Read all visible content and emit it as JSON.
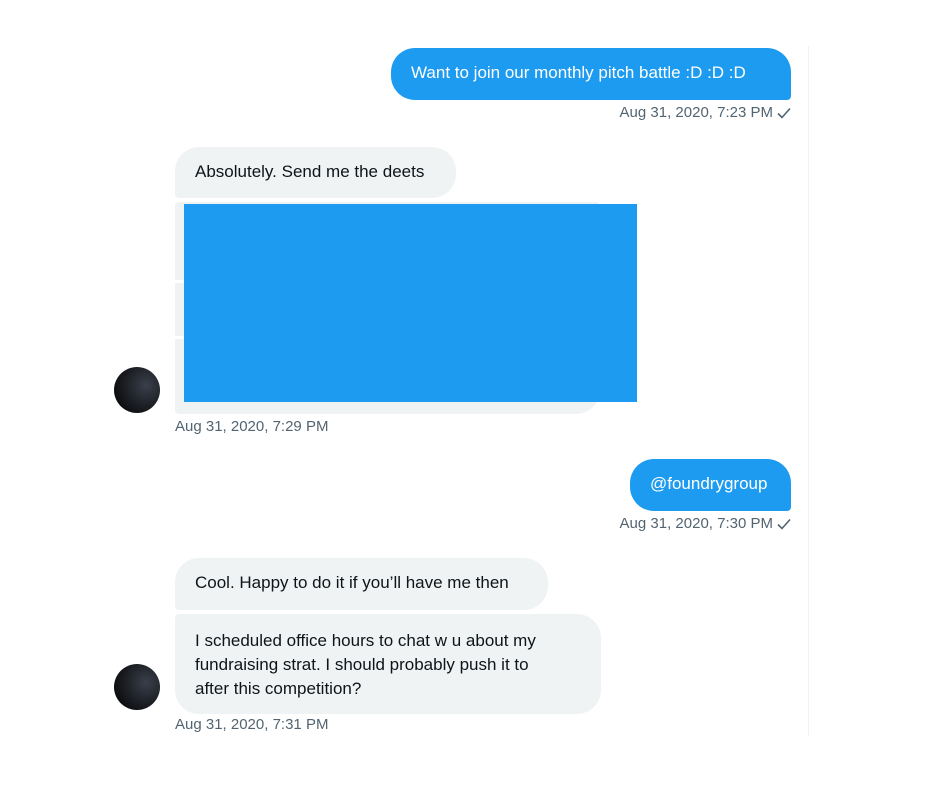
{
  "conversation": {
    "messages": [
      {
        "direction": "outgoing",
        "text": "Want to join our monthly pitch battle :D :D :D",
        "time": "Aug 31, 2020, 7:23 PM"
      },
      {
        "direction": "incoming",
        "text": "Absolutely. Send me the deets",
        "time": "Aug 31, 2020, 7:29 PM"
      },
      {
        "direction": "outgoing",
        "text": "@foundrygroup",
        "time": "Aug 31, 2020, 7:30 PM"
      },
      {
        "direction": "incoming",
        "text": "Cool. Happy to do it if you’ll have me then",
        "time": ""
      },
      {
        "direction": "incoming",
        "lines": [
          "I scheduled office hours to chat w u about my",
          "fundraising strat. I should probably push it to",
          "after this competition?"
        ],
        "time": "Aug 31, 2020, 7:31 PM"
      }
    ]
  },
  "colors": {
    "accent": "#1d9bf0",
    "incoming_bg": "#eff3f4",
    "timestamp": "#536471"
  },
  "icons": {
    "read_receipt": "check-icon",
    "redaction": "redacted-block"
  }
}
